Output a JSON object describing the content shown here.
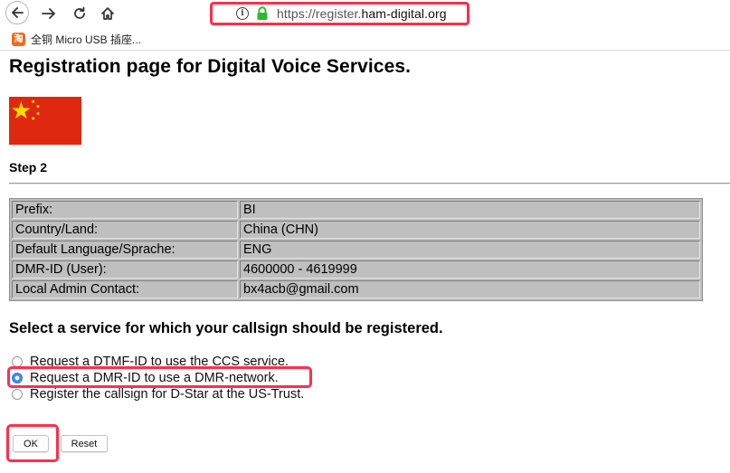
{
  "browser": {
    "url_prefix": "https://register.",
    "url_domain": "ham-digital.org",
    "bookmark_label": "全铜 Micro USB 插座...",
    "bookmark_icon": "taobao-icon"
  },
  "page": {
    "title": "Registration page for Digital Voice Services.",
    "flag": "china-flag",
    "step": "Step 2",
    "info_rows": [
      {
        "key": "Prefix:",
        "value": "BI"
      },
      {
        "key": "Country/Land:",
        "value": "China (CHN)"
      },
      {
        "key": "Default Language/Sprache:",
        "value": "ENG"
      },
      {
        "key": "DMR-ID (User):",
        "value": "4600000 - 4619999"
      },
      {
        "key": "Local Admin Contact:",
        "value": "bx4acb@gmail.com"
      }
    ],
    "service_heading": "Select a service for which your callsign should be registered.",
    "options": [
      {
        "label": "Request a DTMF-ID to use the CCS service.",
        "checked": false
      },
      {
        "label": "Request a DMR-ID to use a DMR-network.",
        "checked": true
      },
      {
        "label": "Register the callsign for D-Star at the US-Trust.",
        "checked": false
      }
    ],
    "ok_label": "OK",
    "reset_label": "Reset"
  },
  "colors": {
    "highlight": "#ff2e4a",
    "flag_red": "#de2910",
    "flag_star": "#ffde00",
    "table_bg": "#bfbfbf",
    "radio_selected": "#2f7de1"
  }
}
